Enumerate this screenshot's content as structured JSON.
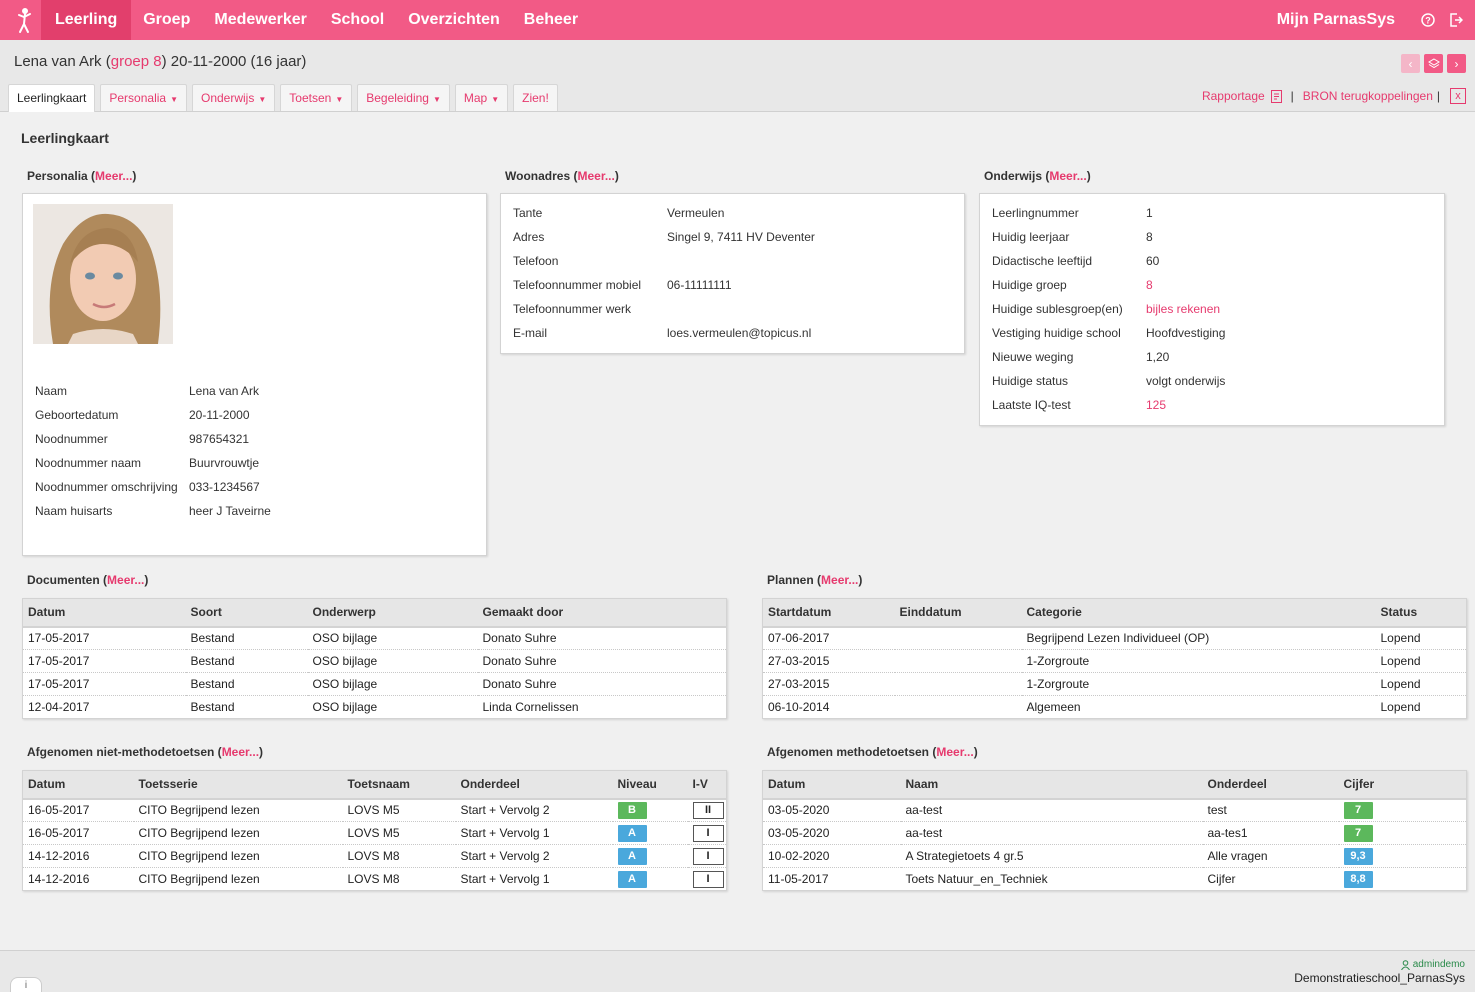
{
  "nav": {
    "items": [
      "Leerling",
      "Groep",
      "Medewerker",
      "School",
      "Overzichten",
      "Beheer"
    ],
    "mijn": "Mijn ParnasSys"
  },
  "header": {
    "name": "Lena van Ark (",
    "group_link": "groep 8",
    "rest": ") 20-11-2000 (16 jaar)"
  },
  "tabs": [
    {
      "label": "Leerlingkaart",
      "dropdown": false
    },
    {
      "label": "Personalia",
      "dropdown": true
    },
    {
      "label": "Onderwijs",
      "dropdown": true
    },
    {
      "label": "Toetsen",
      "dropdown": true
    },
    {
      "label": "Begeleiding",
      "dropdown": true
    },
    {
      "label": "Map",
      "dropdown": true
    },
    {
      "label": "Zien!",
      "dropdown": false
    }
  ],
  "tab_right": {
    "rapportage": "Rapportage",
    "sep": "|",
    "bron": "BRON terugkoppelingen",
    "sep2": "|",
    "close": "x"
  },
  "page_title": "Leerlingkaart",
  "meer": "Meer...",
  "personalia": {
    "title": "Personalia",
    "rows": [
      {
        "k": "Naam",
        "v": "Lena van Ark"
      },
      {
        "k": "Geboortedatum",
        "v": "20-11-2000"
      },
      {
        "k": "Noodnummer",
        "v": "987654321"
      },
      {
        "k": "Noodnummer naam",
        "v": "Buurvrouwtje"
      },
      {
        "k": "Noodnummer omschrijving",
        "v": "033-1234567"
      },
      {
        "k": "Naam huisarts",
        "v": "heer J Taveirne"
      }
    ]
  },
  "woonadres": {
    "title": "Woonadres",
    "rows": [
      {
        "k": "Tante",
        "v": "Vermeulen"
      },
      {
        "k": "Adres",
        "v": "Singel 9, 7411 HV Deventer"
      },
      {
        "k": "Telefoon",
        "v": ""
      },
      {
        "k": "Telefoonnummer mobiel",
        "v": "06-11111111"
      },
      {
        "k": "Telefoonnummer werk",
        "v": ""
      },
      {
        "k": "E-mail",
        "v": "loes.vermeulen@topicus.nl"
      }
    ]
  },
  "onderwijs": {
    "title": "Onderwijs",
    "rows": [
      {
        "k": "Leerlingnummer",
        "v": "1",
        "link": false
      },
      {
        "k": "Huidig leerjaar",
        "v": "8",
        "link": false
      },
      {
        "k": "Didactische leeftijd",
        "v": "60",
        "link": false
      },
      {
        "k": "Huidige groep",
        "v": "8",
        "link": true
      },
      {
        "k": "Huidige sublesgroep(en)",
        "v": "bijles rekenen",
        "link": true
      },
      {
        "k": "Vestiging huidige school",
        "v": "Hoofdvestiging",
        "link": false
      },
      {
        "k": "Nieuwe weging",
        "v": "1,20",
        "link": false
      },
      {
        "k": "Huidige status",
        "v": "volgt onderwijs",
        "link": false
      },
      {
        "k": "Laatste IQ-test",
        "v": "125",
        "link": true
      }
    ]
  },
  "documenten": {
    "title": "Documenten",
    "headers": [
      "Datum",
      "Soort",
      "Onderwerp",
      "Gemaakt door"
    ],
    "rows": [
      [
        "17-05-2017",
        "Bestand",
        "OSO bijlage",
        "Donato Suhre"
      ],
      [
        "17-05-2017",
        "Bestand",
        "OSO bijlage",
        "Donato Suhre"
      ],
      [
        "17-05-2017",
        "Bestand",
        "OSO bijlage",
        "Donato Suhre"
      ],
      [
        "12-04-2017",
        "Bestand",
        "OSO bijlage",
        "Linda Cornelissen"
      ]
    ]
  },
  "plannen": {
    "title": "Plannen",
    "headers": [
      "Startdatum",
      "Einddatum",
      "Categorie",
      "Status"
    ],
    "rows": [
      [
        "07-06-2017",
        "",
        "Begrijpend Lezen Individueel (OP)",
        "Lopend"
      ],
      [
        "27-03-2015",
        "",
        "1-Zorgroute",
        "Lopend"
      ],
      [
        "27-03-2015",
        "",
        "1-Zorgroute",
        "Lopend"
      ],
      [
        "06-10-2014",
        "",
        "Algemeen",
        "Lopend"
      ]
    ]
  },
  "niet_methode": {
    "title": "Afgenomen niet-methodetoetsen",
    "headers": [
      "Datum",
      "Toetsserie",
      "Toetsnaam",
      "Onderdeel",
      "Niveau",
      "I-V"
    ],
    "rows": [
      [
        "16-05-2017",
        "CITO Begrijpend lezen",
        "LOVS M5",
        "Start + Vervolg 2",
        "B",
        "II"
      ],
      [
        "16-05-2017",
        "CITO Begrijpend lezen",
        "LOVS M5",
        "Start + Vervolg 1",
        "A",
        "I"
      ],
      [
        "14-12-2016",
        "CITO Begrijpend lezen",
        "LOVS M8",
        "Start + Vervolg 2",
        "A",
        "I"
      ],
      [
        "14-12-2016",
        "CITO Begrijpend lezen",
        "LOVS M8",
        "Start + Vervolg 1",
        "A",
        "I"
      ]
    ],
    "niveau_colors": {
      "B": "#5cb85c",
      "A": "#4aa8dc"
    }
  },
  "methode": {
    "title": "Afgenomen methodetoetsen",
    "headers": [
      "Datum",
      "Naam",
      "Onderdeel",
      "Cijfer"
    ],
    "rows": [
      [
        "03-05-2020",
        "aa-test",
        "test",
        "7"
      ],
      [
        "03-05-2020",
        "aa-test",
        "aa-tes1",
        "7"
      ],
      [
        "10-02-2020",
        "A Strategietoets 4 gr.5",
        "Alle vragen",
        "9,3"
      ],
      [
        "11-05-2017",
        "Toets Natuur_en_Techniek",
        "Cijfer",
        "8,8"
      ]
    ],
    "cijfer_colors": [
      "#5cb85c",
      "#5cb85c",
      "#4aa8dc",
      "#4aa8dc"
    ]
  },
  "footer": {
    "user": "admindemo",
    "school": "Demonstratieschool_ParnasSys",
    "info": "i"
  },
  "colors": {
    "brand": "#f25a86",
    "link": "#e63a6e"
  }
}
